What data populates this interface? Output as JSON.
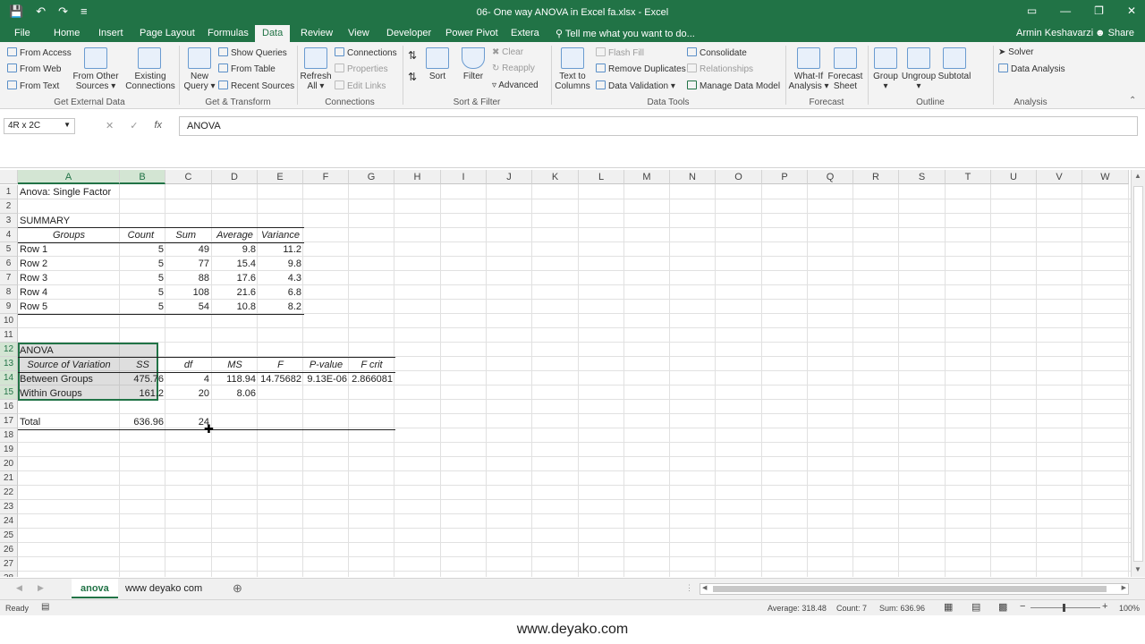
{
  "window": {
    "title": "06- One way ANOVA in Excel fa.xlsx - Excel",
    "user": "Armin Keshavarzi",
    "share": "Share",
    "tell_me": "Tell me what you want to do..."
  },
  "tabs": [
    "File",
    "Home",
    "Insert",
    "Page Layout",
    "Formulas",
    "Data",
    "Review",
    "View",
    "Developer",
    "Power Pivot",
    "Extera"
  ],
  "active_tab": "Data",
  "ribbon": {
    "get_external": {
      "from_access": "From Access",
      "from_web": "From Web",
      "from_text": "From Text",
      "from_other": "From Other",
      "sources": "Sources",
      "existing": "Existing",
      "connections": "Connections",
      "label": "Get External Data"
    },
    "get_transform": {
      "new": "New",
      "query": "Query",
      "show_queries": "Show Queries",
      "from_table": "From Table",
      "recent_sources": "Recent Sources",
      "label": "Get & Transform"
    },
    "connections": {
      "refresh": "Refresh",
      "all": "All",
      "connections": "Connections",
      "properties": "Properties",
      "edit_links": "Edit Links",
      "label": "Connections"
    },
    "sort_filter": {
      "sort": "Sort",
      "filter": "Filter",
      "clear": "Clear",
      "reapply": "Reapply",
      "advanced": "Advanced",
      "label": "Sort & Filter"
    },
    "data_tools": {
      "text_to": "Text to",
      "columns": "Columns",
      "flash_fill": "Flash Fill",
      "remove_duplicates": "Remove Duplicates",
      "data_validation": "Data Validation",
      "consolidate": "Consolidate",
      "relationships": "Relationships",
      "manage_data_model": "Manage Data Model",
      "label": "Data Tools"
    },
    "forecast": {
      "what_if": "What-If",
      "analysis": "Analysis",
      "forecast": "Forecast",
      "sheet": "Sheet",
      "label": "Forecast"
    },
    "outline": {
      "group": "Group",
      "ungroup": "Ungroup",
      "subtotal": "Subtotal",
      "label": "Outline"
    },
    "analysis": {
      "solver": "Solver",
      "data_analysis": "Data Analysis",
      "label": "Analysis"
    }
  },
  "formula_bar": {
    "name_box": "4R x 2C",
    "content": "ANOVA",
    "fx": "fx"
  },
  "columns": [
    "A",
    "B",
    "C",
    "D",
    "E",
    "F",
    "G",
    "H",
    "I",
    "J",
    "K",
    "L",
    "M",
    "N",
    "O",
    "P",
    "Q",
    "R",
    "S",
    "T",
    "U",
    "V",
    "W"
  ],
  "rows": [
    "1",
    "2",
    "3",
    "4",
    "5",
    "6",
    "7",
    "8",
    "9",
    "10",
    "11",
    "12",
    "13",
    "14",
    "15",
    "16",
    "17",
    "18",
    "19",
    "20",
    "21",
    "22",
    "23",
    "24",
    "25",
    "26",
    "27",
    "28"
  ],
  "sheet": {
    "a1": "Anova: Single Factor",
    "a3": "SUMMARY",
    "summary_headers": [
      "Groups",
      "Count",
      "Sum",
      "Average",
      "Variance"
    ],
    "summary_rows": [
      [
        "Row 1",
        "5",
        "49",
        "9.8",
        "11.2"
      ],
      [
        "Row 2",
        "5",
        "77",
        "15.4",
        "9.8"
      ],
      [
        "Row 3",
        "5",
        "88",
        "17.6",
        "4.3"
      ],
      [
        "Row 4",
        "5",
        "108",
        "21.6",
        "6.8"
      ],
      [
        "Row 5",
        "5",
        "54",
        "10.8",
        "8.2"
      ]
    ],
    "a12": "ANOVA",
    "anova_headers": [
      "Source of Variation",
      "SS",
      "df",
      "MS",
      "F",
      "P-value",
      "F crit"
    ],
    "anova_rows": [
      [
        "Between Groups",
        "475.76",
        "4",
        "118.94",
        "14.75682",
        "9.13E-06",
        "2.866081"
      ],
      [
        "Within Groups",
        "161.2",
        "20",
        "8.06",
        "",
        "",
        ""
      ]
    ],
    "total": [
      "Total",
      "636.96",
      "24"
    ]
  },
  "sheet_tabs": [
    "anova",
    "www deyako com"
  ],
  "status": {
    "ready": "Ready",
    "average": "Average: 318.48",
    "count": "Count: 7",
    "sum": "Sum: 636.96",
    "zoom": "100%"
  },
  "watermark": "www.deyako.com"
}
